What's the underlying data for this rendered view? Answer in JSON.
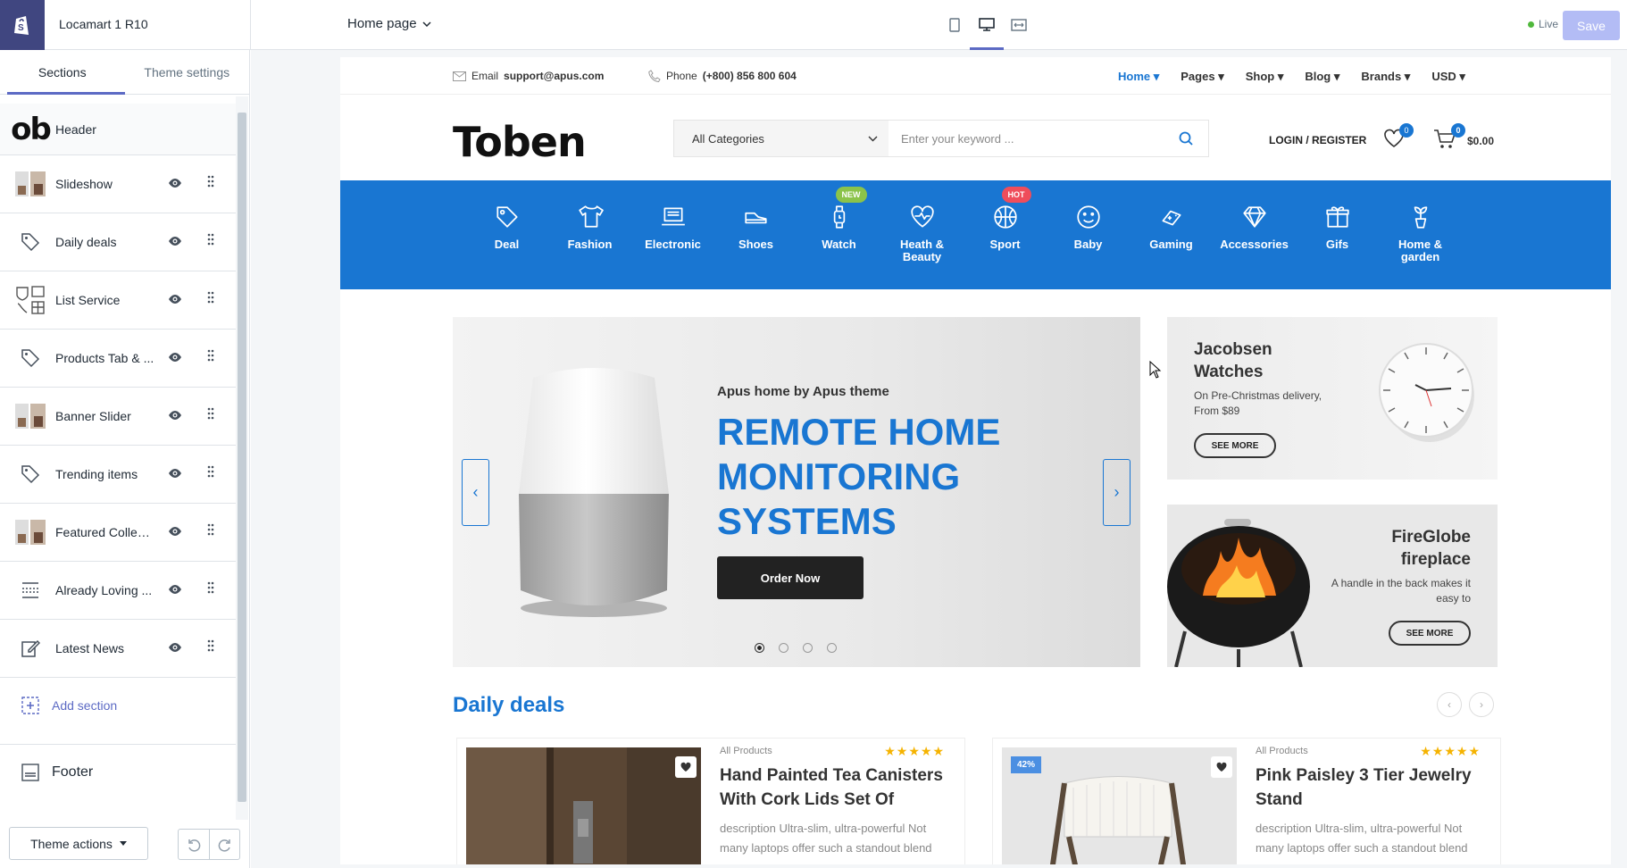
{
  "editor": {
    "store_name": "Locamart 1 R10",
    "page_select": "Home page",
    "live_label": "Live",
    "save_label": "Save",
    "theme_actions_label": "Theme actions"
  },
  "sidebar": {
    "tabs": [
      {
        "label": "Sections",
        "active": true
      },
      {
        "label": "Theme settings",
        "active": false
      }
    ],
    "header_label": "Header",
    "items": [
      {
        "label": "Slideshow",
        "icon": "image-thumb"
      },
      {
        "label": "Daily deals",
        "icon": "tag-icon"
      },
      {
        "label": "List Service",
        "icon": "service-thumb"
      },
      {
        "label": "Products Tab & ...",
        "icon": "tag-icon"
      },
      {
        "label": "Banner Slider",
        "icon": "image-thumb"
      },
      {
        "label": "Trending items",
        "icon": "tag-icon"
      },
      {
        "label": "Featured Collect...",
        "icon": "image-thumb"
      },
      {
        "label": "Already Loving ...",
        "icon": "rows-icon"
      },
      {
        "label": "Latest News",
        "icon": "edit-icon"
      }
    ],
    "add_section_label": "Add section",
    "footer_label": "Footer"
  },
  "store": {
    "email_label": "Email",
    "email": "support@apus.com",
    "phone_label": "Phone",
    "phone": "(+800) 856 800 604",
    "nav": [
      {
        "label": "Home",
        "active": true
      },
      {
        "label": "Pages",
        "active": false
      },
      {
        "label": "Shop",
        "active": false
      },
      {
        "label": "Blog",
        "active": false
      },
      {
        "label": "Brands",
        "active": false
      },
      {
        "label": "USD",
        "active": false
      }
    ],
    "logo_text": "Toben",
    "search_category": "All Categories",
    "search_placeholder": "Enter your keyword ...",
    "login_label": "LOGIN / REGISTER",
    "wishlist_count": "0",
    "cart_count": "0",
    "cart_total": "$0.00",
    "categories": [
      {
        "label": "Deal",
        "icon": "tag-icon",
        "tag": ""
      },
      {
        "label": "Fashion",
        "icon": "shirt-icon",
        "tag": ""
      },
      {
        "label": "Electronic",
        "icon": "laptop-icon",
        "tag": ""
      },
      {
        "label": "Shoes",
        "icon": "shoe-icon",
        "tag": ""
      },
      {
        "label": "Watch",
        "icon": "watch-icon",
        "tag": "NEW"
      },
      {
        "label": "Heath & Beauty",
        "icon": "heart-pulse-icon",
        "tag": ""
      },
      {
        "label": "Sport",
        "icon": "basketball-icon",
        "tag": "HOT"
      },
      {
        "label": "Baby",
        "icon": "smile-icon",
        "tag": ""
      },
      {
        "label": "Gaming",
        "icon": "gamepad-icon",
        "tag": ""
      },
      {
        "label": "Accessories",
        "icon": "diamond-icon",
        "tag": ""
      },
      {
        "label": "Gifs",
        "icon": "gift-icon",
        "tag": ""
      },
      {
        "label": "Home & garden",
        "icon": "plant-icon",
        "tag": ""
      }
    ],
    "slider": {
      "subtitle": "Apus home by Apus theme",
      "title": "REMOTE HOME MONITORING SYSTEMS",
      "button": "Order Now",
      "slide_count": 4,
      "active_slide": 1
    },
    "banners": [
      {
        "title": "Jacobsen Watches",
        "text": "On Pre-Christmas delivery, From $89",
        "button": "SEE MORE"
      },
      {
        "title": "FireGlobe fireplace",
        "text": "A handle in the back makes it easy to",
        "button": "SEE MORE"
      }
    ],
    "daily_deals_title": "Daily deals",
    "products": [
      {
        "category": "All Products",
        "stars": "★★★★★",
        "name": "Hand Painted Tea Canisters With Cork Lids Set Of",
        "desc": "description Ultra-slim, ultra-powerful Not many laptops offer such a standout blend",
        "badge": ""
      },
      {
        "category": "All Products",
        "stars": "★★★★★",
        "name": "Pink Paisley 3 Tier Jewelry Stand",
        "desc": "description Ultra-slim, ultra-powerful Not many laptops offer such a standout blend",
        "badge": "42%"
      }
    ]
  }
}
